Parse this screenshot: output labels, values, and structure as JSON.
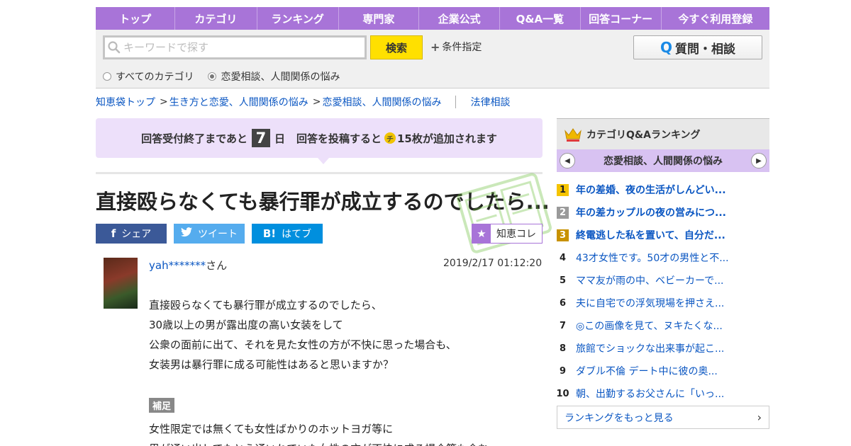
{
  "nav": [
    "トップ",
    "カテゴリ",
    "ランキング",
    "専門家",
    "企業公式",
    "Q&A一覧",
    "回答コーナー",
    "今すぐ利用登録"
  ],
  "search": {
    "placeholder": "キーワードで探す",
    "button": "検索",
    "conditions": "条件指定",
    "ask_button": "質問・相談",
    "radio_all": "すべてのカテゴリ",
    "radio_current": "恋愛相談、人間関係の悩み"
  },
  "breadcrumb": [
    "知恵袋トップ",
    "生き方と恋愛、人間関係の悩み",
    "恋愛相談、人間関係の悩み"
  ],
  "breadcrumb_extra": "法律相談",
  "deadline": {
    "prefix": "回答受付終了まであと",
    "days": "7",
    "day_unit": "日",
    "reward_prefix": "回答を投稿すると",
    "coin": "チ",
    "reward_suffix": "15枚が追加されます"
  },
  "question": {
    "title": "直接殴らなくても暴行罪が成立するのでしたら...",
    "user": "yah*******",
    "user_suffix": "さん",
    "date": "2019/2/17  01:12:20",
    "body": [
      "直接殴らなくても暴行罪が成立するのでしたら、",
      "30歳以上の男が露出度の高い女装をして",
      "公衆の面前に出て、それを見た女性の方が不快に思った場合も、",
      "女装男は暴行罪に成る可能性はあると思いますか？"
    ],
    "supplement_label": "補足",
    "supplement": [
      "女性限定では無くても女性ばかりのホットヨガ等に",
      "男が通い出してたとえ通いれていた女性の方が不快に成る場合等も含む"
    ]
  },
  "share": {
    "facebook": "シェア",
    "twitter": "ツイート",
    "hatena": "はてブ",
    "chiecore": "知恵コレ"
  },
  "ranking": {
    "title": "カテゴリQ&Aランキング",
    "category": "恋愛相談、人間関係の悩み",
    "items": [
      {
        "no": "1",
        "text": "年の差婚、夜の生活がしんどい..."
      },
      {
        "no": "2",
        "text": "年の差カップルの夜の営みにつ..."
      },
      {
        "no": "3",
        "text": "終電逃した私を置いて、自分だ..."
      },
      {
        "no": "4",
        "text": "43才女性です。50才の男性と不..."
      },
      {
        "no": "5",
        "text": "ママ友が雨の中、ベビーカーで..."
      },
      {
        "no": "6",
        "text": "夫に自宅での浮気現場を押さえ..."
      },
      {
        "no": "7",
        "text": "◎この画像を見て、ヌキたくな..."
      },
      {
        "no": "8",
        "text": "旅館でショックな出来事が起こ..."
      },
      {
        "no": "9",
        "text": "ダブル不倫 デート中に彼の奥..."
      },
      {
        "no": "10",
        "text": "朝、出勤するお父さんに「いっ..."
      }
    ],
    "more": "ランキングをもっと見る"
  },
  "colors": {
    "nav": "#a874d8",
    "link": "#0a56c2",
    "banner": "#ede0fa",
    "search_btn": "#ffe000"
  }
}
